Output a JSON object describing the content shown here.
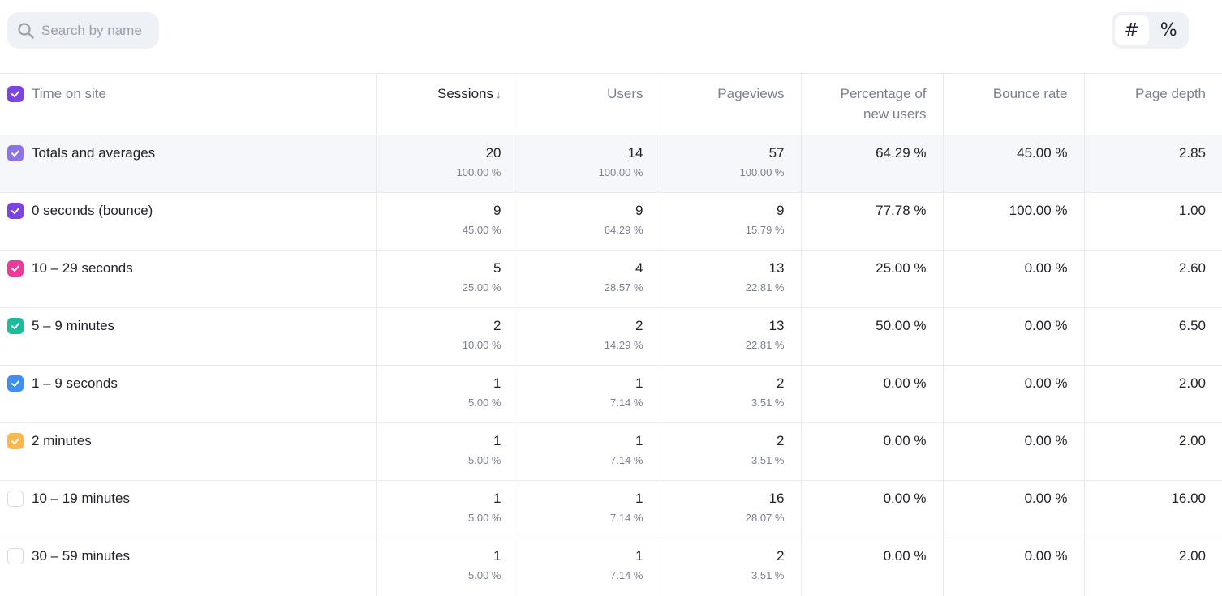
{
  "search": {
    "placeholder": "Search by name"
  },
  "toggle": {
    "absolute_label": "#",
    "percent_label": "%",
    "active": "absolute"
  },
  "columns": {
    "dimension": "Time on site",
    "sessions": "Sessions",
    "sessions_sort": "↓",
    "users": "Users",
    "pageviews": "Pageviews",
    "pct_new_users_line1": "Percentage of",
    "pct_new_users_line2": "new users",
    "bounce_rate": "Bounce rate",
    "page_depth": "Page depth"
  },
  "header_checkbox_color": "#7b44e3",
  "rows": [
    {
      "label": "Totals and averages",
      "color": "#8e73e2",
      "checked": true,
      "sessions": "20",
      "sessions_pct": "100.00 %",
      "users": "14",
      "users_pct": "100.00 %",
      "pageviews": "57",
      "pageviews_pct": "100.00 %",
      "new_users": "64.29 %",
      "bounce": "45.00 %",
      "depth": "2.85"
    },
    {
      "label": "0 seconds (bounce)",
      "color": "#7b44e3",
      "checked": true,
      "sessions": "9",
      "sessions_pct": "45.00 %",
      "users": "9",
      "users_pct": "64.29 %",
      "pageviews": "9",
      "pageviews_pct": "15.79 %",
      "new_users": "77.78 %",
      "bounce": "100.00 %",
      "depth": "1.00"
    },
    {
      "label": "10 – 29 seconds",
      "color": "#f03a9b",
      "checked": true,
      "sessions": "5",
      "sessions_pct": "25.00 %",
      "users": "4",
      "users_pct": "28.57 %",
      "pageviews": "13",
      "pageviews_pct": "22.81 %",
      "new_users": "25.00 %",
      "bounce": "0.00 %",
      "depth": "2.60"
    },
    {
      "label": "5 – 9 minutes",
      "color": "#1bbc9c",
      "checked": true,
      "sessions": "2",
      "sessions_pct": "10.00 %",
      "users": "2",
      "users_pct": "14.29 %",
      "pageviews": "13",
      "pageviews_pct": "22.81 %",
      "new_users": "50.00 %",
      "bounce": "0.00 %",
      "depth": "6.50"
    },
    {
      "label": "1 – 9 seconds",
      "color": "#3d8ff2",
      "checked": true,
      "sessions": "1",
      "sessions_pct": "5.00 %",
      "users": "1",
      "users_pct": "7.14 %",
      "pageviews": "2",
      "pageviews_pct": "3.51 %",
      "new_users": "0.00 %",
      "bounce": "0.00 %",
      "depth": "2.00"
    },
    {
      "label": "2 minutes",
      "color": "#fcb74d",
      "checked": true,
      "sessions": "1",
      "sessions_pct": "5.00 %",
      "users": "1",
      "users_pct": "7.14 %",
      "pageviews": "2",
      "pageviews_pct": "3.51 %",
      "new_users": "0.00 %",
      "bounce": "0.00 %",
      "depth": "2.00"
    },
    {
      "label": "10 – 19 minutes",
      "color": "",
      "checked": false,
      "sessions": "1",
      "sessions_pct": "5.00 %",
      "users": "1",
      "users_pct": "7.14 %",
      "pageviews": "16",
      "pageviews_pct": "28.07 %",
      "new_users": "0.00 %",
      "bounce": "0.00 %",
      "depth": "16.00"
    },
    {
      "label": "30 – 59 minutes",
      "color": "",
      "checked": false,
      "sessions": "1",
      "sessions_pct": "5.00 %",
      "users": "1",
      "users_pct": "7.14 %",
      "pageviews": "2",
      "pageviews_pct": "3.51 %",
      "new_users": "0.00 %",
      "bounce": "0.00 %",
      "depth": "2.00"
    }
  ]
}
